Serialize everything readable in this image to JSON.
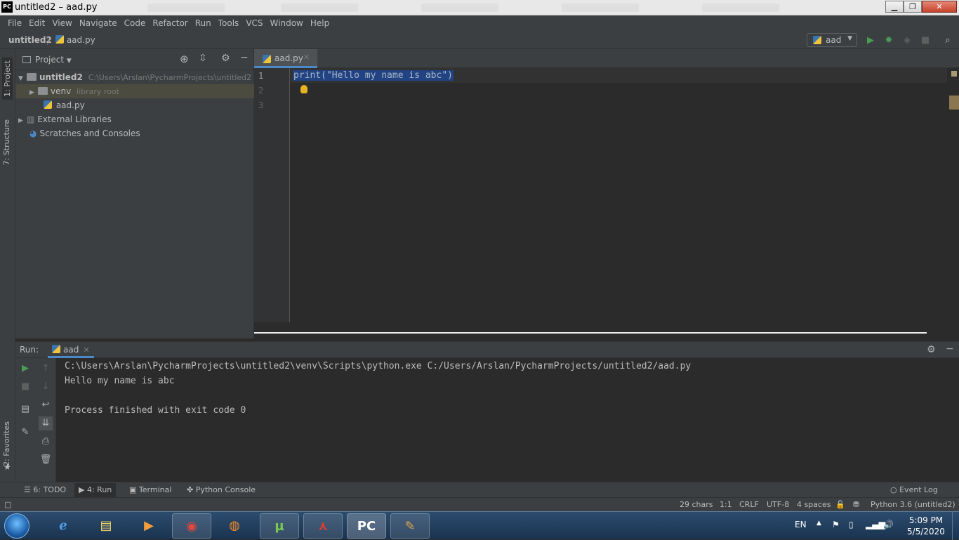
{
  "window": {
    "title": "untitled2 – aad.py",
    "app_icon": "PC",
    "controls": {
      "minimize": "▁",
      "maximize": "❐",
      "close": "✕"
    }
  },
  "menu": {
    "items": [
      "File",
      "Edit",
      "View",
      "Navigate",
      "Code",
      "Refactor",
      "Run",
      "Tools",
      "VCS",
      "Window",
      "Help"
    ]
  },
  "navbar": {
    "project": "untitled2",
    "separator": "〉",
    "file": "aad.py",
    "run_config": "aad",
    "icons": [
      "run-icon",
      "debug-icon",
      "coverage-icon",
      "stop-icon",
      "search-icon"
    ]
  },
  "left_strip": {
    "project_tab": "1: Project",
    "structure_tab": "7: Structure",
    "favorites_tab": "2: Favorites"
  },
  "project_panel": {
    "title": "Project",
    "tree": [
      {
        "name": "untitled2",
        "path": "C:\\Users\\Arslan\\PycharmProjects\\untitled2"
      },
      {
        "name": "venv",
        "note": "library root"
      },
      {
        "name": "aad.py"
      },
      {
        "name": "External Libraries"
      },
      {
        "name": "Scratches and Consoles"
      }
    ]
  },
  "editor": {
    "tab_label": "aad.py",
    "line_numbers": [
      "1",
      "2",
      "3"
    ],
    "code_line_1": "print(\"Hello my name is abc\")"
  },
  "run_panel": {
    "label": "Run:",
    "tab": "aad",
    "console": [
      "C:\\Users\\Arslan\\PycharmProjects\\untitled2\\venv\\Scripts\\python.exe C:/Users/Arslan/PycharmProjects/untitled2/aad.py",
      "Hello my name is abc",
      "",
      "Process finished with exit code 0"
    ]
  },
  "bottom_tabs": {
    "todo": "6: TODO",
    "run": "4: Run",
    "terminal": "Terminal",
    "python_console": "Python Console",
    "event_log": "Event Log"
  },
  "status_bar": {
    "chars": "29 chars",
    "position": "1:1",
    "line_sep": "CRLF",
    "encoding": "UTF-8",
    "indent": "4 spaces",
    "interpreter": "Python 3.6 (untitled2)"
  },
  "taskbar": {
    "apps": [
      "ie",
      "explorer",
      "media",
      "chrome",
      "firefox",
      "utorrent",
      "acrobat",
      "pycharm",
      "paint"
    ],
    "language": "EN",
    "time": "5:09 PM",
    "date": "5/5/2020"
  },
  "colors": {
    "accent": "#4a88c7",
    "selection": "#214283",
    "panel": "#3c3f41",
    "editor": "#2b2b2b",
    "run_green": "#499c54"
  }
}
